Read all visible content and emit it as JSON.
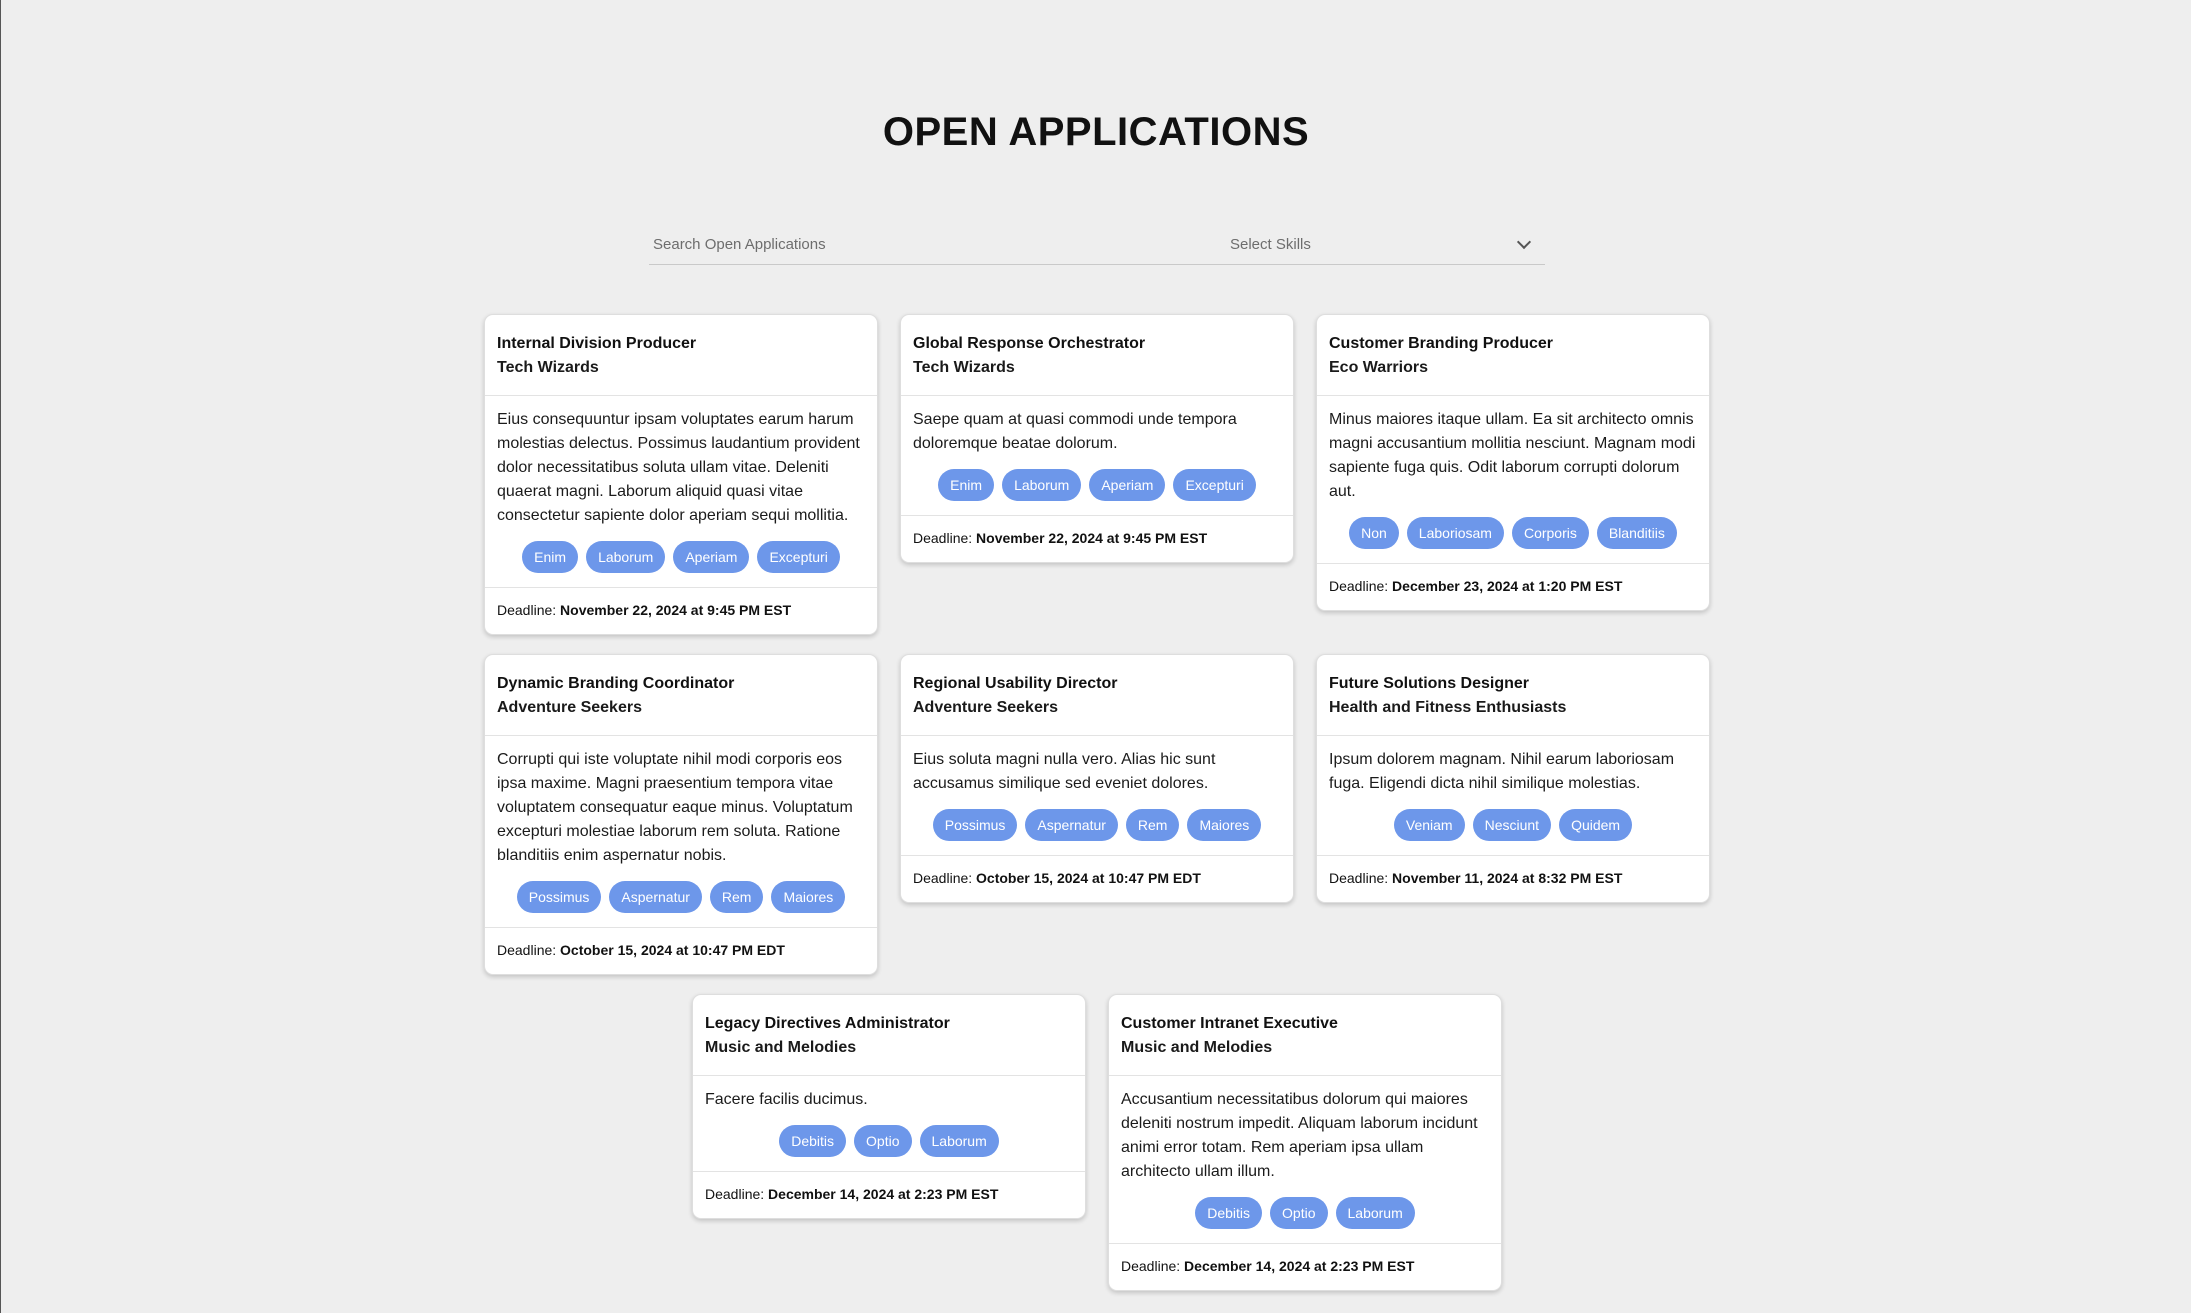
{
  "header": {
    "title": "OPEN APPLICATIONS"
  },
  "filters": {
    "search_placeholder": "Search Open Applications",
    "skills_placeholder": "Select Skills"
  },
  "deadline_label": "Deadline:",
  "cards": [
    {
      "title": "Internal Division Producer",
      "company": "Tech Wizards",
      "description": "Eius consequuntur ipsam voluptates earum harum molestias delectus. Possimus laudantium provident dolor necessitatibus soluta ullam vitae. Deleniti quaerat magni. Laborum aliquid quasi vitae consectetur sapiente dolor aperiam sequi mollitia.",
      "skills": [
        "Enim",
        "Laborum",
        "Aperiam",
        "Excepturi"
      ],
      "deadline": "November 22, 2024 at 9:45 PM EST"
    },
    {
      "title": "Global Response Orchestrator",
      "company": "Tech Wizards",
      "description": "Saepe quam at quasi commodi unde tempora doloremque beatae dolorum.",
      "skills": [
        "Enim",
        "Laborum",
        "Aperiam",
        "Excepturi"
      ],
      "deadline": "November 22, 2024 at 9:45 PM EST"
    },
    {
      "title": "Customer Branding Producer",
      "company": "Eco Warriors",
      "description": "Minus maiores itaque ullam. Ea sit architecto omnis magni accusantium mollitia nesciunt. Magnam modi sapiente fuga quis. Odit laborum corrupti dolorum aut.",
      "skills": [
        "Non",
        "Laboriosam",
        "Corporis",
        "Blanditiis"
      ],
      "deadline": "December 23, 2024 at 1:20 PM EST"
    },
    {
      "title": "Dynamic Branding Coordinator",
      "company": "Adventure Seekers",
      "description": "Corrupti qui iste voluptate nihil modi corporis eos ipsa maxime. Magni praesentium tempora vitae voluptatem consequatur eaque minus. Voluptatum excepturi molestiae laborum rem soluta. Ratione blanditiis enim aspernatur nobis.",
      "skills": [
        "Possimus",
        "Aspernatur",
        "Rem",
        "Maiores"
      ],
      "deadline": "October 15, 2024 at 10:47 PM EDT"
    },
    {
      "title": "Regional Usability Director",
      "company": "Adventure Seekers",
      "description": "Eius soluta magni nulla vero. Alias hic sunt accusamus similique sed eveniet dolores.",
      "skills": [
        "Possimus",
        "Aspernatur",
        "Rem",
        "Maiores"
      ],
      "deadline": "October 15, 2024 at 10:47 PM EDT"
    },
    {
      "title": "Future Solutions Designer",
      "company": "Health and Fitness Enthusiasts",
      "description": "Ipsum dolorem magnam. Nihil earum laboriosam fuga. Eligendi dicta nihil similique molestias.",
      "skills": [
        "Veniam",
        "Nesciunt",
        "Quidem"
      ],
      "deadline": "November 11, 2024 at 8:32 PM EST"
    },
    {
      "title": "Legacy Directives Administrator",
      "company": "Music and Melodies",
      "description": "Facere facilis ducimus.",
      "skills": [
        "Debitis",
        "Optio",
        "Laborum"
      ],
      "deadline": "December 14, 2024 at 2:23 PM EST"
    },
    {
      "title": "Customer Intranet Executive",
      "company": "Music and Melodies",
      "description": "Accusantium necessitatibus dolorum qui maiores deleniti nostrum impedit. Aliquam laborum incidunt animi error totam. Rem aperiam ipsa ullam architecto ullam illum.",
      "skills": [
        "Debitis",
        "Optio",
        "Laborum"
      ],
      "deadline": "December 14, 2024 at 2:23 PM EST"
    }
  ]
}
